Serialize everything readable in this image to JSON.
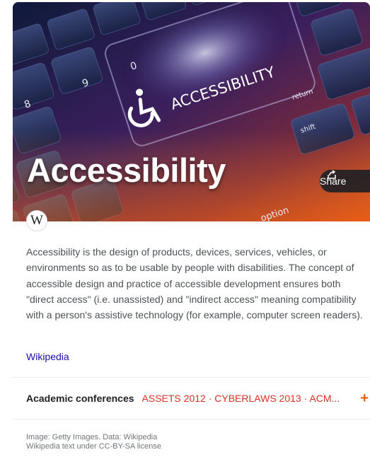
{
  "hero": {
    "title": "Accessibility",
    "image_text": "ACCESSIBILITY",
    "key_labels": [
      "8",
      "9",
      "0",
      "shift",
      "return",
      "option"
    ]
  },
  "share": {
    "label": "Share",
    "icon": "share-icon"
  },
  "source": {
    "logo_text": "W",
    "icon": "wikipedia-logo"
  },
  "description": {
    "text": "Accessibility is the design of products, devices, services, vehicles, or environments so as to be usable by people with disabilities. The concept of accessible design and practice of accessible development ensures both \"direct access\" (i.e. unassisted) and \"indirect access\" meaning compatibility with a person's assistive technology (for example, computer screen readers).",
    "link_label": "Wikipedia"
  },
  "attributes": {
    "academic_conferences": {
      "label": "Academic conferences",
      "values": [
        "ASSETS 2012",
        "CYBERLAWS 2013",
        "ACM..."
      ],
      "separator": " · ",
      "expand_icon": "plus-icon"
    }
  },
  "footer": {
    "line1": "Image: Getty Images. Data: Wikipedia",
    "line2": "Wikipedia text under CC-BY-SA license"
  },
  "colors": {
    "link": "#1a0dab",
    "attribute_value": "#d93025",
    "accent_plus": "#e8610a"
  }
}
